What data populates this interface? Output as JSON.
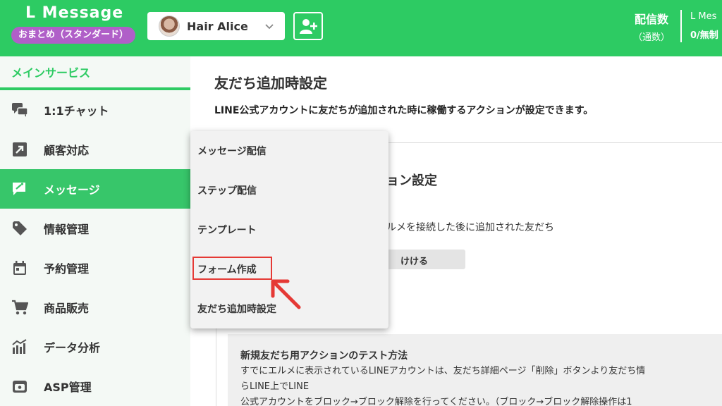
{
  "header": {
    "brand": "L Message",
    "plan_badge": "おまとめ（スタンダード）",
    "account_name": "Hair Alice",
    "delivery_label": "配信数",
    "delivery_sub": "（通数）",
    "right_label": "L Mes",
    "right_value": "0/無制"
  },
  "sidebar": {
    "heading": "メインサービス",
    "items": [
      {
        "label": "1:1チャット",
        "icon": "chat-icon"
      },
      {
        "label": "顧客対応",
        "icon": "arrow-box-icon"
      },
      {
        "label": "メッセージ",
        "icon": "message-icon"
      },
      {
        "label": "情報管理",
        "icon": "tag-icon"
      },
      {
        "label": "予約管理",
        "icon": "calendar-icon"
      },
      {
        "label": "商品販売",
        "icon": "cart-icon"
      },
      {
        "label": "データ分析",
        "icon": "chart-icon"
      },
      {
        "label": "ASP管理",
        "icon": "wallet-icon"
      }
    ]
  },
  "main": {
    "title": "友だち追加時設定",
    "description": "LINE公式アカウントに友だちが追加された時に稼働するアクションが設定できます。",
    "card_title_partial": "ョン設定",
    "card_text_partial": "ルメを接続した後に追加された友だち",
    "button_partial": "けける",
    "note_title": "新規友だち用アクションのテスト方法",
    "note_line1": "すでにエルメに表示されているLINEアカウントは、友だち詳細ページ「削除」ボタンより友だち情",
    "note_line2": "らLINE上でLINE",
    "note_line3": "公式アカウントをブロック→ブロック解除を行ってください。（ブロック→ブロック解除操作は1"
  },
  "dropdown": {
    "items": [
      "メッセージ配信",
      "ステップ配信",
      "テンプレート",
      "フォーム作成",
      "友だち追加時設定"
    ]
  },
  "colors": {
    "brand_green": "#2dcb63",
    "active_green": "#37c66a",
    "badge_purple": "#b05fc8",
    "highlight_red": "#e53935"
  }
}
